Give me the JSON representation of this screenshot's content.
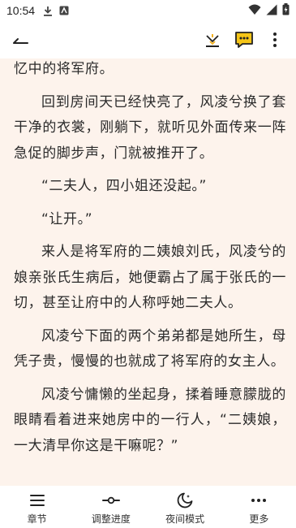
{
  "status_bar": {
    "time": "10:54"
  },
  "toolbar": {
    "back_icon": "back-arrow-icon",
    "download_icon": "download-icon",
    "comment_icon": "comment-icon",
    "more_icon": "more-vertical-icon"
  },
  "content": {
    "paragraphs": [
      "忆中的将军府。",
      "回到房间天已经快亮了，风凌兮换了套干净的衣裳，刚躺下，就听见外面传来一阵急促的脚步声，门就被推开了。",
      "“二夫人，四小姐还没起。”",
      "“让开。”",
      "来人是将军府的二姨娘刘氏，风凌兮的娘亲张氏生病后，她便霸占了属于张氏的一切，甚至让府中的人称呼她二夫人。",
      "风凌兮下面的两个弟弟都是她所生，母凭子贵，慢慢的也就成了将军府的女主人。",
      "风凌兮慵懒的坐起身，揉着睡意朦胧的眼睛看着进来她房中的一行人，“二姨娘，一大清早你这是干嘛呢？”"
    ]
  },
  "bottom_nav": {
    "items": [
      {
        "label": "章节",
        "icon": "chapters-icon"
      },
      {
        "label": "调整进度",
        "icon": "progress-slider-icon"
      },
      {
        "label": "夜间模式",
        "icon": "night-mode-icon"
      },
      {
        "label": "更多",
        "icon": "more-horizontal-icon"
      }
    ]
  },
  "colors": {
    "reader_background": "#fdf3ec",
    "text": "#2a2a2a"
  }
}
